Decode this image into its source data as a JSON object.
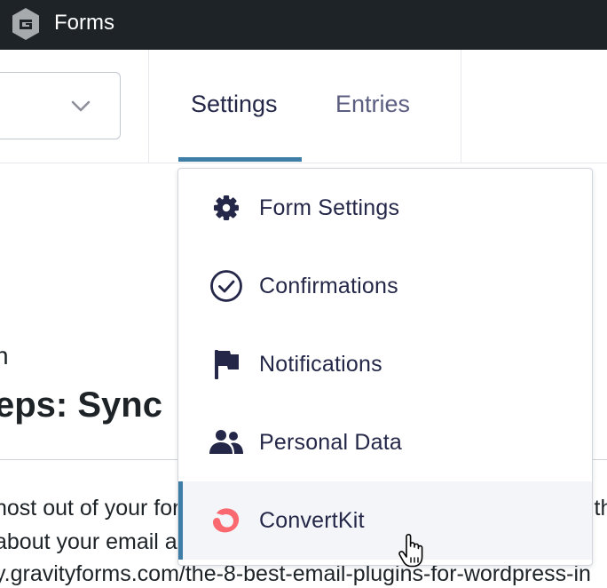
{
  "topbar": {
    "title": "Forms"
  },
  "header": {
    "tabs": [
      {
        "label": "Settings",
        "active": true
      },
      {
        "label": "Entries",
        "active": false
      }
    ]
  },
  "background": {
    "subtitle": "n",
    "heading": "eps: Sync",
    "paragraph_lines": [
      "nost out of your for",
      "about your email a",
      "y.gravityforms.com/the-8-best-email-plugins-for-wordpress-in"
    ],
    "trailing_fragment": "ith"
  },
  "menu": {
    "items": [
      {
        "label": "Form Settings",
        "icon": "gear-icon"
      },
      {
        "label": "Confirmations",
        "icon": "check-circle-icon"
      },
      {
        "label": "Notifications",
        "icon": "flag-icon"
      },
      {
        "label": "Personal Data",
        "icon": "people-icon"
      },
      {
        "label": "ConvertKit",
        "icon": "convertkit-icon",
        "active": true
      }
    ]
  },
  "colors": {
    "accent": "#3e7da6",
    "admin_bar": "#1d2327",
    "menu_text": "#242748",
    "convertkit": "#fb6970"
  }
}
